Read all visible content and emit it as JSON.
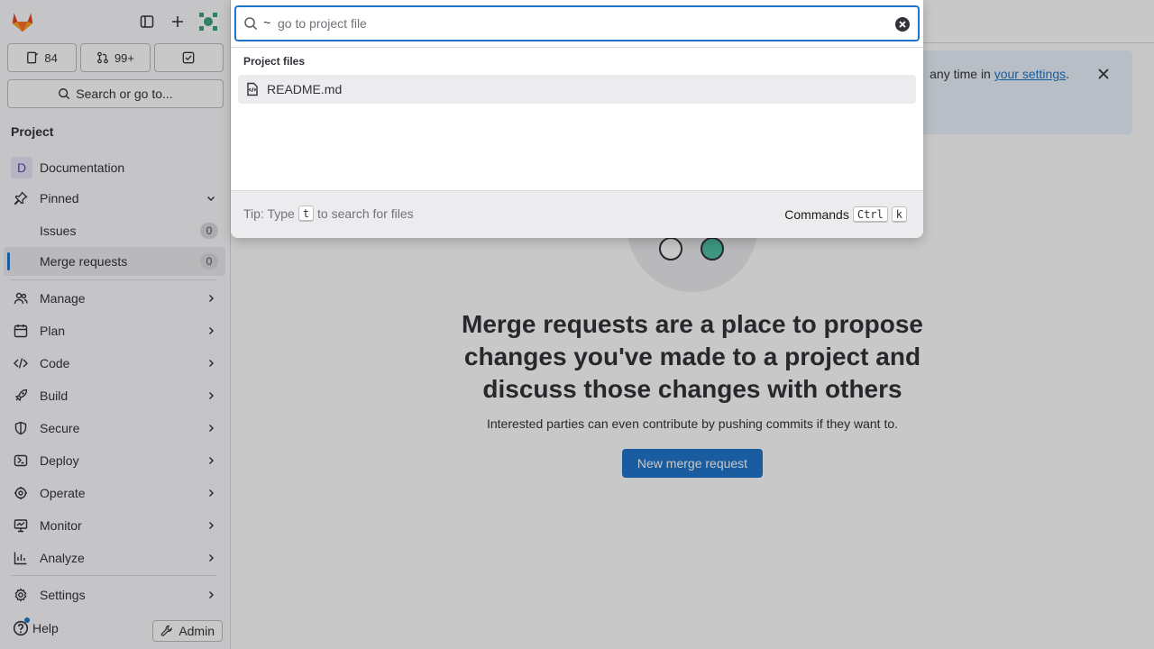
{
  "sidebar": {
    "counts": {
      "issues": "84",
      "merge_requests": "99+"
    },
    "search_label": "Search or go to...",
    "section_title": "Project",
    "project": {
      "avatar_letter": "D",
      "name": "Documentation"
    },
    "pinned": {
      "label": "Pinned",
      "items": [
        {
          "label": "Issues",
          "count": "0"
        },
        {
          "label": "Merge requests",
          "count": "0"
        }
      ]
    },
    "groups": [
      {
        "label": "Manage"
      },
      {
        "label": "Plan"
      },
      {
        "label": "Code"
      },
      {
        "label": "Build"
      },
      {
        "label": "Secure"
      },
      {
        "label": "Deploy"
      },
      {
        "label": "Operate"
      },
      {
        "label": "Monitor"
      },
      {
        "label": "Analyze"
      }
    ],
    "settings_label": "Settings",
    "help_label": "Help",
    "admin_label": "Admin"
  },
  "main": {
    "alert": {
      "text_prefix": "any time in ",
      "link": "your settings",
      "text_suffix": "."
    },
    "empty_state": {
      "title": "Merge requests are a place to propose changes you've made to a project and discuss those changes with others",
      "description": "Interested parties can even contribute by pushing commits if they want to.",
      "button": "New merge request"
    }
  },
  "modal": {
    "search_prefix": "~",
    "search_placeholder": "go to project file",
    "group_title": "Project files",
    "results": [
      {
        "name": "README.md"
      }
    ],
    "footer": {
      "tip_prefix": "Tip: Type",
      "tip_key": "t",
      "tip_suffix": "to search for files",
      "commands_label": "Commands",
      "commands_keys": [
        "Ctrl",
        "k"
      ]
    }
  },
  "colors": {
    "accent": "#1f75cb",
    "sidebar_bg": "#fbfafd",
    "alert_bg": "#e9f3fc"
  }
}
